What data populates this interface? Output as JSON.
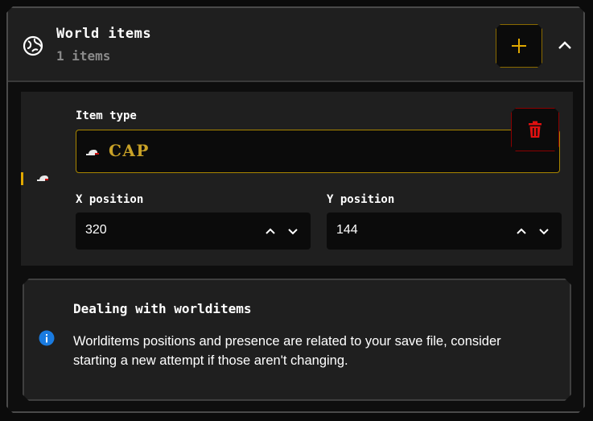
{
  "section": {
    "title": "World items",
    "subtitle": "1 items",
    "icon": "globe-icon",
    "add_icon": "plus-icon",
    "collapse_icon": "chevron-up-icon"
  },
  "item": {
    "type_label": "Item type",
    "type_value": "CAP",
    "type_icon": "cap-icon",
    "delete_icon": "trash-icon",
    "x_label": "X position",
    "x_value": "320",
    "y_label": "Y position",
    "y_value": "144"
  },
  "info": {
    "icon": "info-icon",
    "title": "Dealing with worlditems",
    "text": "Worlditems positions and presence are related to your save file, consider starting a new attempt if those aren't changing."
  },
  "colors": {
    "accent": "#e0a800",
    "danger": "#d01010",
    "info": "#1a7be0",
    "panel": "#1f1f1f"
  }
}
